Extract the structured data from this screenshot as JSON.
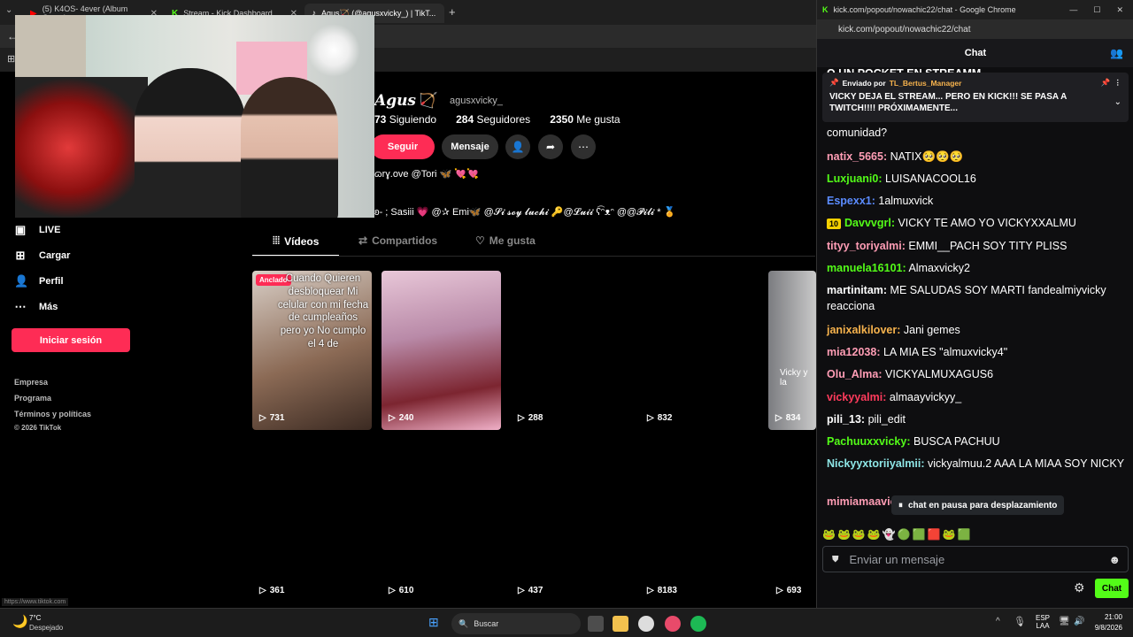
{
  "tabs": [
    {
      "label": "(5) K4OS- 4ever (Album Compl...",
      "icon": "youtube-icon"
    },
    {
      "label": "Stream - Kick Dashboard",
      "icon": "kick-icon"
    },
    {
      "label": "Agus🏹 (@agusxvicky_) | TikT...",
      "icon": "tiktok-icon"
    }
  ],
  "profile": {
    "name": "Agus🏹",
    "username": "agusxvicky_",
    "following_count": "73",
    "following_label": "Siguiendo",
    "followers_count": "284",
    "followers_label": "Seguidores",
    "likes_count": "2350",
    "likes_label": "Me gusta",
    "follow_btn": "Seguir",
    "message_btn": "Mensaje",
    "bio1": "ɷrɣ.ove @Tori 🦋 💘💘",
    "bio2": "ʚ- ; Sasiii 💗 @✰ Emi🦋 @𝓢𝓲 𝓼𝓸𝔂 𝓵𝓾𝓬𝓱𝓲 🔑@𝓛𝓾𝓲𝓲 ʕ͡ᵔᴥᵔ @@𝓟𝓲𝓵𝓲 * 🏅"
  },
  "content_tabs": [
    {
      "label": "Vídeos",
      "icon": "grid-icon"
    },
    {
      "label": "Compartidos",
      "icon": "repost-icon"
    },
    {
      "label": "Me gusta",
      "icon": "heart-icon"
    }
  ],
  "sidebar": {
    "items": [
      {
        "label": "LIVE",
        "icon": "live-icon"
      },
      {
        "label": "Cargar",
        "icon": "upload-icon"
      },
      {
        "label": "Perfil",
        "icon": "profile-icon"
      },
      {
        "label": "Más",
        "icon": "more-icon"
      }
    ],
    "login": "Iniciar sesión",
    "footer": [
      "Empresa",
      "Programa",
      "Términos y políticas",
      "© 2026 TikTok"
    ]
  },
  "videos_row1": [
    {
      "views": "731",
      "pinned_label": "Anclado",
      "caption": "Cuando Quieren desbloquear Mi celular con mi fecha de cumpleaños pero yo No cumplo el 4 de"
    },
    {
      "views": "240"
    },
    {
      "views": "288"
    },
    {
      "views": "832"
    },
    {
      "views": "834",
      "caption": "Vicky y la"
    }
  ],
  "videos_row2": [
    {
      "views": "361"
    },
    {
      "views": "610"
    },
    {
      "views": "437"
    },
    {
      "views": "8183"
    },
    {
      "views": "693"
    }
  ],
  "status_url": "https://www.tiktok.com",
  "kick": {
    "window_title": "kick.com/popout/nowachic22/chat - Google Chrome",
    "address": "kick.com/popout/nowachic22/chat",
    "header": "Chat",
    "partial_top": "O UN POCKET EN STREAMM",
    "pinned_by_label": "Enviado por",
    "pinned_by_user": "TL_Bertus_Manager",
    "pinned_text": "VICKY DEJA EL STREAM... PERO EN KICK!!! SE PASA A TWITCH!!!! PRÓXIMAMENTE...",
    "partial_line": "comunidad?",
    "messages": [
      {
        "user": "natix_5665",
        "text": " NATIX🥺🥺🥺",
        "color": "#ff9db5"
      },
      {
        "user": "Luxjuani0",
        "text": " LUISANACOOL16",
        "color": "#53fc18"
      },
      {
        "user": "Espexx1",
        "text": " 1almuxvick",
        "color": "#5b8cff"
      },
      {
        "user": "Davvvgrl",
        "text": " VICKY TE AMO YO VICKYXXALMU",
        "color": "#53fc18",
        "badge": "10"
      },
      {
        "user": "tityy_toriyalmi",
        "text": " EMMI__PACH SOY TITY PLISS",
        "color": "#ff9db5"
      },
      {
        "user": "manuela16101",
        "text": " Almaxvicky2",
        "color": "#53fc18"
      },
      {
        "user": "martinitam",
        "text": " ME SALUDAS SOY MARTI fandealmiyvicky reacciona",
        "color": "#ffffff"
      },
      {
        "user": "janixalkilover",
        "text": " Jani gemes",
        "color": "#f7b34d"
      },
      {
        "user": "mia12038",
        "text": " LA MIA ES \"almuxvicky4\"",
        "color": "#ff9db5"
      },
      {
        "user": "Olu_Alma",
        "text": " VICKYALMUXAGUS6",
        "color": "#ff9db5"
      },
      {
        "user": "vickyyalmi",
        "text": " almaayvickyy_",
        "color": "#ff3b5c"
      },
      {
        "user": "pili_13",
        "text": " pili_edit",
        "color": "#ffffff"
      },
      {
        "user": "Pachuuxxvicky",
        "text": " BUSCA PACHUU",
        "color": "#53fc18"
      },
      {
        "user": "Nickyyxtoriiyalmii",
        "text": " vickyalmuu.2 AAA LA MIAA SOY NICKY",
        "color": "#8ee6e6"
      }
    ],
    "last_partial_user": "mimiamaavic",
    "pause_label": "chat en pausa para desplazamiento",
    "input_placeholder": "Enviar un mensaje",
    "chat_button": "Chat"
  },
  "taskbar": {
    "weather_temp": "7°C",
    "weather_text": "Despejado",
    "search_placeholder": "Buscar",
    "lang1": "ESP",
    "lang2": "LAA",
    "time": "21:00",
    "date": "9/8/2026"
  },
  "colors": {
    "tiktok_red": "#fe2c55",
    "kick_green": "#53fc18"
  }
}
